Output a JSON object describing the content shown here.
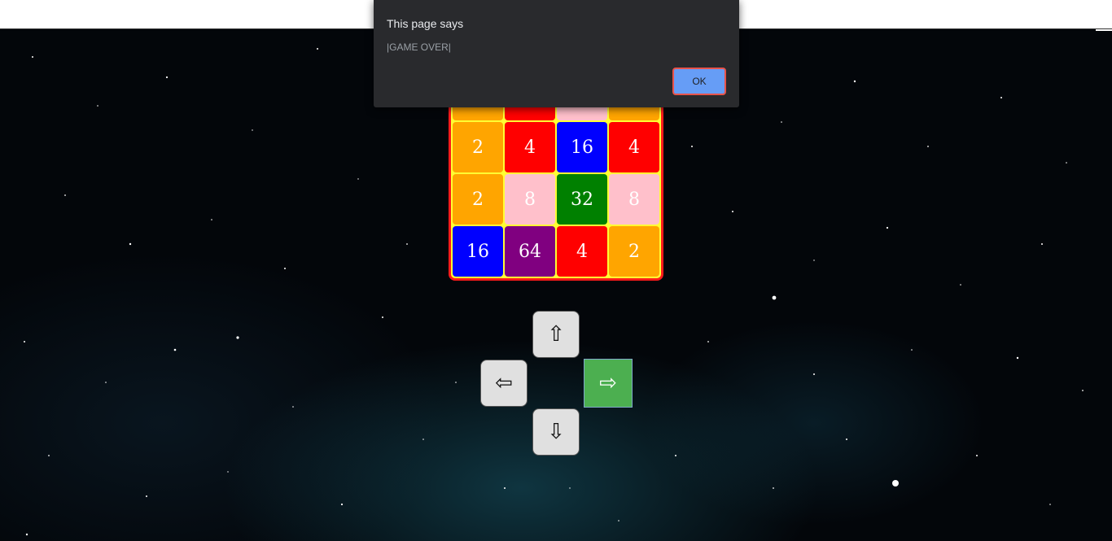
{
  "dialog": {
    "title": "This page says",
    "message": "|GAME OVER|",
    "ok_label": "OK"
  },
  "board": {
    "rows": 4,
    "cols": 4,
    "partial_top_row_colors": [
      "#ffa500",
      "#ff0000",
      "#ffc0cb",
      "#ffa500"
    ],
    "tiles": [
      [
        {
          "value": "2",
          "color": "#ffa500"
        },
        {
          "value": "4",
          "color": "#ff0000"
        },
        {
          "value": "16",
          "color": "#0000ff"
        },
        {
          "value": "4",
          "color": "#ff0000"
        }
      ],
      [
        {
          "value": "2",
          "color": "#ffa500"
        },
        {
          "value": "8",
          "color": "#ffc0cb"
        },
        {
          "value": "32",
          "color": "#008000"
        },
        {
          "value": "8",
          "color": "#ffc0cb"
        }
      ],
      [
        {
          "value": "16",
          "color": "#0000ff"
        },
        {
          "value": "64",
          "color": "#800080"
        },
        {
          "value": "4",
          "color": "#ff0000"
        },
        {
          "value": "2",
          "color": "#ffa500"
        }
      ]
    ]
  },
  "controls": {
    "up": {
      "glyph": "⇧",
      "icon": "arrow-up-icon"
    },
    "left": {
      "glyph": "⇦",
      "icon": "arrow-left-icon"
    },
    "right": {
      "glyph": "⇨",
      "icon": "arrow-right-icon"
    },
    "down": {
      "glyph": "⇩",
      "icon": "arrow-down-icon"
    }
  },
  "colors": {
    "board_background": "#ffff33",
    "board_border": "#ff1a1a",
    "active_control": "#4caf50",
    "ok_button": "#669df6"
  }
}
